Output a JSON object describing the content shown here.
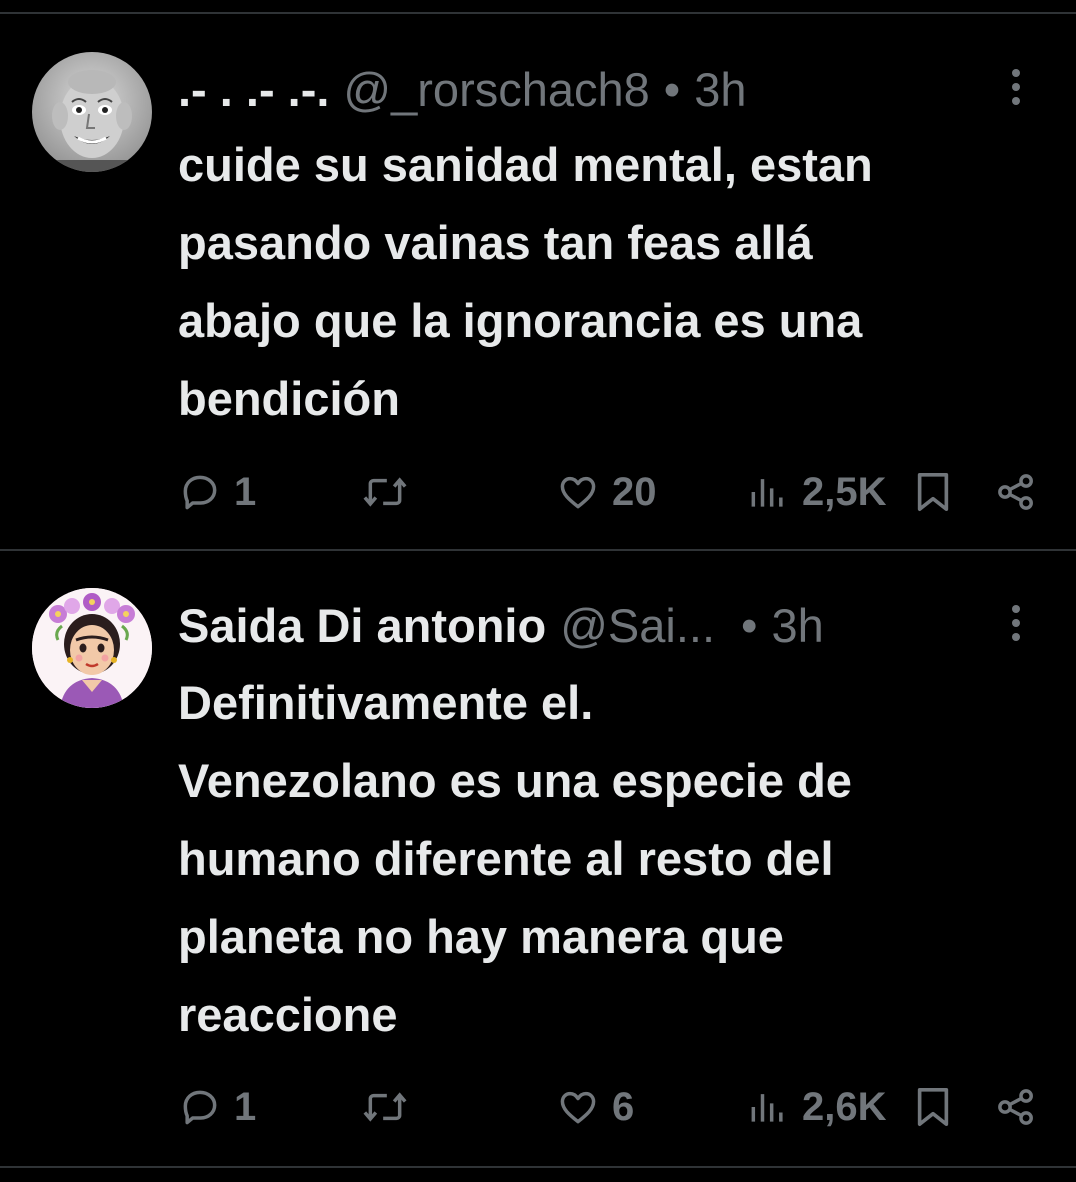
{
  "tweets": [
    {
      "display_name": ".- . .- .-.",
      "handle": "@_rorschach8",
      "separator": "•",
      "time": "3h",
      "text_lines": [
        "cuide su sanidad mental, estan",
        "pasando vainas tan feas allá",
        "abajo que la ignorancia es una",
        "bendición"
      ],
      "replies": "1",
      "retweets": "",
      "likes": "20",
      "views": "2,5K",
      "icons": [
        "reply-icon",
        "retweet-icon",
        "like-icon",
        "views-icon",
        "bookmark-icon",
        "share-icon",
        "more-icon"
      ]
    },
    {
      "display_name": "Saida Di antonio",
      "handle": "@Sai...",
      "separator": "•",
      "time": "3h",
      "text_lines": [
        "Definitivamente el.",
        "Venezolano es una especie de",
        "humano diferente al resto del",
        "planeta no hay manera que",
        "reaccione"
      ],
      "replies": "1",
      "retweets": "",
      "likes": "6",
      "views": "2,6K",
      "icons": [
        "reply-icon",
        "retweet-icon",
        "like-icon",
        "views-icon",
        "bookmark-icon",
        "share-icon",
        "more-icon"
      ]
    }
  ],
  "colors": {
    "background": "#000000",
    "text_primary": "#e7e9ea",
    "text_secondary": "#71767b",
    "divider": "#2f3336"
  }
}
